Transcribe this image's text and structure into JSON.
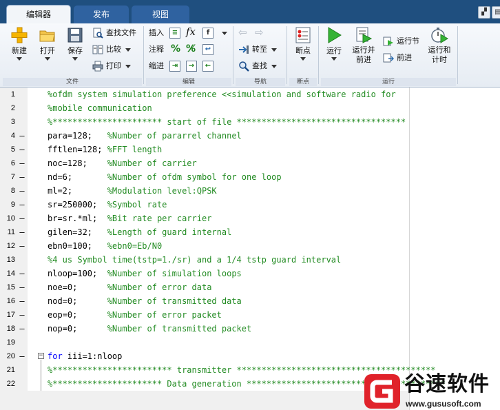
{
  "tabs": [
    {
      "label": "编辑器",
      "active": true
    },
    {
      "label": "发布",
      "active": false
    },
    {
      "label": "视图",
      "active": false
    }
  ],
  "toolstrip": {
    "file": {
      "label": "文件",
      "new": "新建",
      "open": "打开",
      "save": "保存",
      "find_files": "查找文件",
      "compare": "比较",
      "print": "打印"
    },
    "edit": {
      "label": "编辑",
      "insert": "插入",
      "comment": "注释",
      "indent": "缩进",
      "fx": "fx",
      "comment_symbol": "%"
    },
    "navigate": {
      "label": "导航",
      "goto": "转至",
      "find": "查找"
    },
    "breakpoints": {
      "label": "断点",
      "breakpoints": "断点"
    },
    "run": {
      "label": "运行",
      "run": "运行",
      "run_and_advance_line1": "运行并",
      "run_and_advance_line2": "前进",
      "run_section": "运行节",
      "advance": "前进",
      "run_and_time_line1": "运行和",
      "run_and_time_line2": "计时"
    }
  },
  "editor": {
    "lines": [
      {
        "n": "1",
        "dash": "",
        "code": "%ofdm system simulation preference <<simulation and software radio for",
        "kind": "comment"
      },
      {
        "n": "2",
        "dash": "",
        "code": "%mobile communication",
        "kind": "comment"
      },
      {
        "n": "3",
        "dash": "",
        "code": "%********************** start of file **********************************",
        "kind": "comment"
      },
      {
        "n": "4",
        "dash": "–",
        "stmt": "para=128;   ",
        "cmt": "%Number of pararrel channel"
      },
      {
        "n": "5",
        "dash": "–",
        "stmt": "fftlen=128; ",
        "cmt": "%FFT length"
      },
      {
        "n": "6",
        "dash": "–",
        "stmt": "noc=128;    ",
        "cmt": "%Number of carrier"
      },
      {
        "n": "7",
        "dash": "–",
        "stmt": "nd=6;       ",
        "cmt": "%Number of ofdm symbol for one loop"
      },
      {
        "n": "8",
        "dash": "–",
        "stmt": "ml=2;       ",
        "cmt": "%Modulation level:QPSK"
      },
      {
        "n": "9",
        "dash": "–",
        "stmt": "sr=250000;  ",
        "cmt": "%Symbol rate"
      },
      {
        "n": "10",
        "dash": "–",
        "stmt": "br=sr.*ml;  ",
        "cmt": "%Bit rate per carrier"
      },
      {
        "n": "11",
        "dash": "–",
        "stmt": "gilen=32;   ",
        "cmt": "%Length of guard internal"
      },
      {
        "n": "12",
        "dash": "–",
        "stmt": "ebn0=100;   ",
        "cmt": "%ebn0=Eb/N0"
      },
      {
        "n": "13",
        "dash": "",
        "code": "%4 us Symbol time(tstp=1./sr) and a 1/4 tstp guard interval",
        "kind": "comment"
      },
      {
        "n": "14",
        "dash": "–",
        "stmt": "nloop=100;  ",
        "cmt": "%Number of simulation loops"
      },
      {
        "n": "15",
        "dash": "–",
        "stmt": "noe=0;      ",
        "cmt": "%Number of error data"
      },
      {
        "n": "16",
        "dash": "–",
        "stmt": "nod=0;      ",
        "cmt": "%Number of transmitted data"
      },
      {
        "n": "17",
        "dash": "–",
        "stmt": "eop=0;      ",
        "cmt": "%Number of error packet"
      },
      {
        "n": "18",
        "dash": "–",
        "stmt": "nop=0;      ",
        "cmt": "%Number of transmitted packet"
      },
      {
        "n": "19",
        "dash": "",
        "code": "",
        "kind": "plain"
      },
      {
        "n": "20",
        "dash": "–",
        "kw": "for",
        "rest": " iii=1:nloop",
        "fold": "−"
      },
      {
        "n": "21",
        "dash": "",
        "code": "%************************ transmitter ****************************************",
        "kind": "comment"
      },
      {
        "n": "22",
        "dash": "",
        "code": "%********************** Data generation ****************************************",
        "kind": "comment"
      }
    ]
  },
  "watermark": {
    "title": "谷速软件",
    "url": "www.gususoft.com"
  },
  "colors": {
    "tabbar": "#1f4f7f",
    "comment": "#228b22",
    "keyword": "#0000ff",
    "watermark_red": "#e0222a"
  }
}
